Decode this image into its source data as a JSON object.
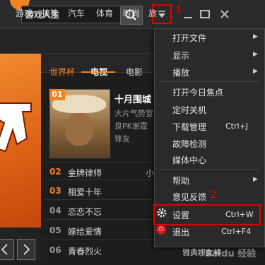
{
  "titlebar": {
    "search_value": "游戏人生",
    "annotation_1": "1"
  },
  "nav": {
    "categories": [
      "游戏",
      "搞笑",
      "汽车",
      "体育",
      "时尚",
      "旅"
    ]
  },
  "content_tabs": [
    "世界杯",
    "电视",
    "电影"
  ],
  "featured": {
    "badge": "01",
    "title": "十月围城",
    "description": "大片气势宣良PK谢霆锋友"
  },
  "list": [
    {
      "num": "02",
      "title": "金牌律师",
      "side": "小"
    },
    {
      "num": "03",
      "title": "相爱十年",
      "side": ""
    },
    {
      "num": "04",
      "title": "恋恋不忘",
      "side": ""
    },
    {
      "num": "05",
      "title": "嫁给爱情",
      "side": ""
    },
    {
      "num": "06",
      "title": "青春烈火",
      "side": ""
    }
  ],
  "menu": {
    "items": [
      {
        "label": "打开文件",
        "submenu": true
      },
      {
        "label": "显示",
        "submenu": true
      },
      {
        "label": "播放",
        "submenu": true
      },
      {
        "label": "打开今日焦点",
        "submenu": false
      },
      {
        "label": "定时关机",
        "submenu": false
      },
      {
        "label": "下载管理",
        "shortcut": "Ctrl+J"
      },
      {
        "label": "故障检测",
        "submenu": false
      },
      {
        "label": "媒体中心",
        "submenu": false
      },
      {
        "label": "帮助",
        "submenu": true
      },
      {
        "label": "意见反馈",
        "annotation": "2"
      },
      {
        "label": "设置",
        "shortcut": "Ctrl+W"
      },
      {
        "label": "退出",
        "shortcut": "Ctrl+F4"
      }
    ]
  },
  "footer": {
    "text": "雅典娜女神",
    "watermark": "Baidu 经验"
  },
  "colors": {
    "accent": "#f58220",
    "annotation_red": "#e00000"
  }
}
